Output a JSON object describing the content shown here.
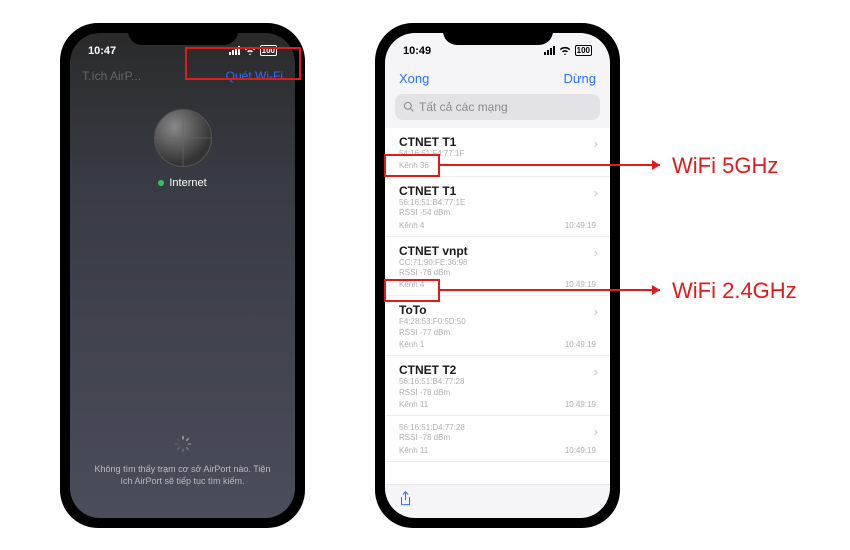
{
  "phone1": {
    "time": "10:47",
    "battery": "100",
    "nav_left": "T.ích AirP...",
    "nav_right": "Quét Wi-Fi",
    "internet_label": "Internet",
    "not_found": "Không tìm thấy trạm cơ sở AirPort nào. Tiện ích AirPort sẽ tiếp tục tìm kiếm."
  },
  "phone2": {
    "time": "10:49",
    "battery": "100",
    "nav_left": "Xong",
    "nav_right": "Dừng",
    "search_placeholder": "Tất cả các mạng",
    "networks": [
      {
        "name": "CTNET T1",
        "mac": "54:16:51:F4:77:1F",
        "rssi": "",
        "channel": "Kênh 36",
        "time": ""
      },
      {
        "name": "CTNET T1",
        "mac": "56:16:51:B4:77:1E",
        "rssi": "RSSI -54 dBm",
        "channel": "Kênh 4",
        "time": "10:49:19"
      },
      {
        "name": "CTNET vnpt",
        "mac": "CC:71:90:FE:36:98",
        "rssi": "RSSI -76 dBm",
        "channel": "Kênh 4",
        "time": "10:49:19"
      },
      {
        "name": "ToTo",
        "mac": "F4:28:53:F0:5D:50",
        "rssi": "RSSI -77 dBm",
        "channel": "Kênh 1",
        "time": "10:49:19"
      },
      {
        "name": "CTNET T2",
        "mac": "56:16:51:B4:77:28",
        "rssi": "RSSI -78 dBm",
        "channel": "Kênh 11",
        "time": "10:49:19"
      },
      {
        "name": "",
        "mac": "56:16:51:D4:77:28",
        "rssi": "RSSI -78 dBm",
        "channel": "Kênh 11",
        "time": "10:49:19"
      }
    ]
  },
  "annotations": {
    "wifi5": "WiFi 5GHz",
    "wifi24": "WiFi 2.4GHz"
  }
}
